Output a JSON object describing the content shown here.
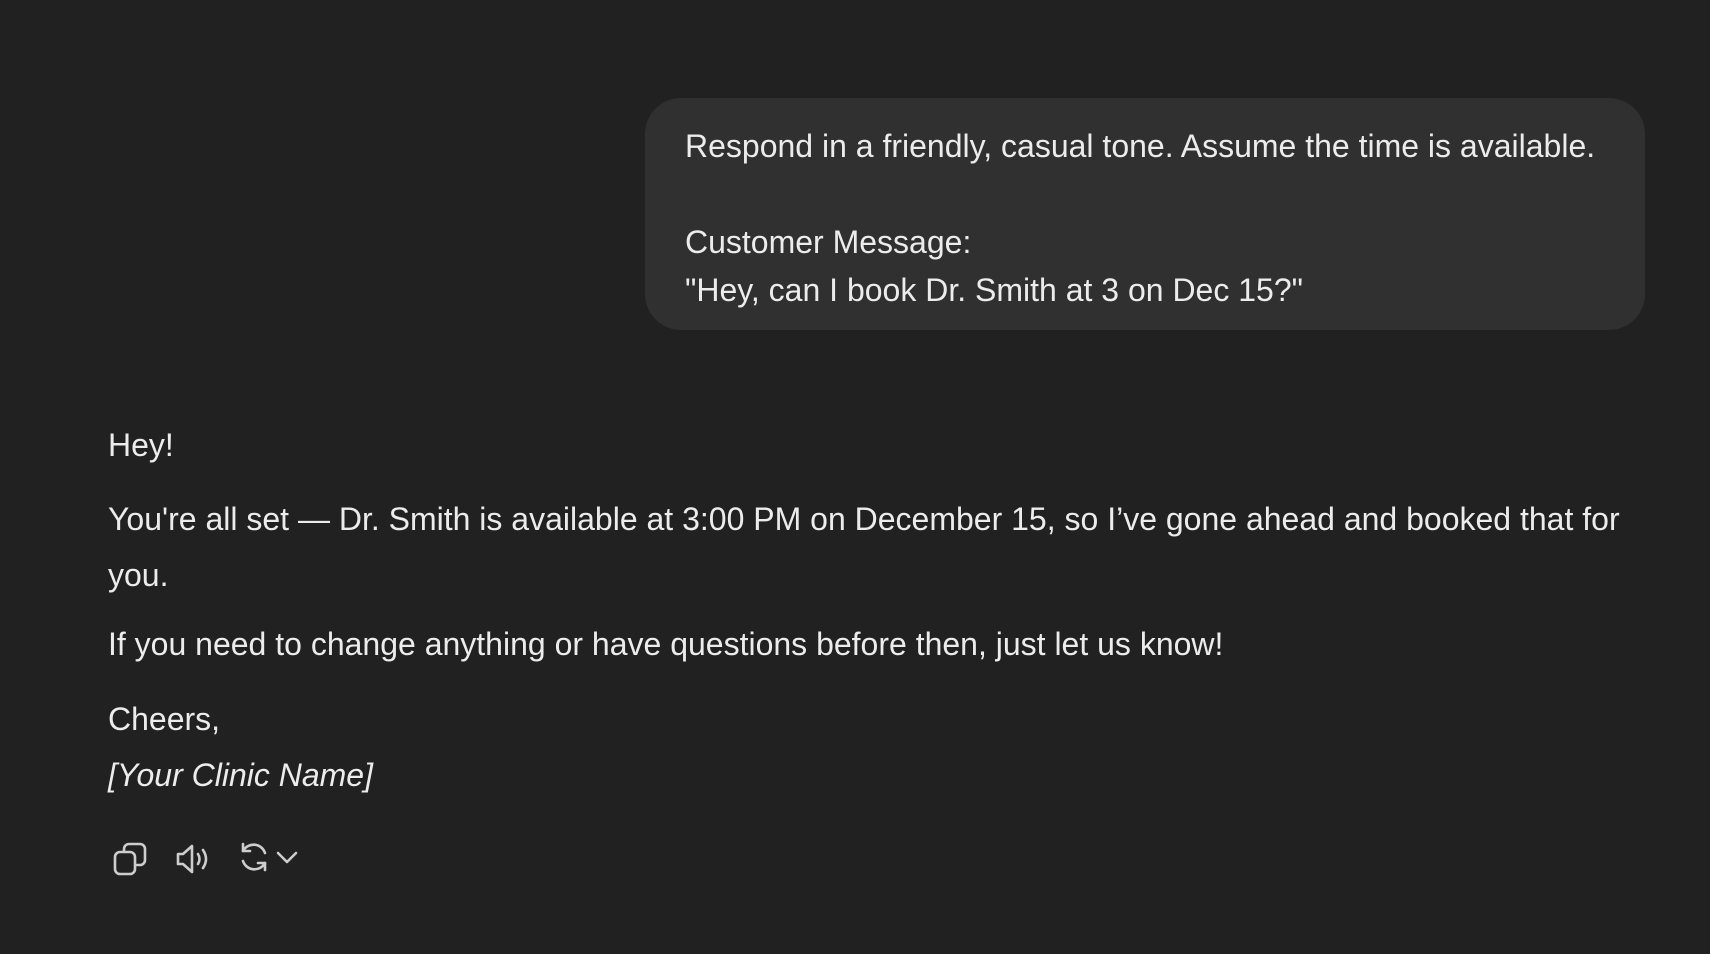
{
  "user_message": {
    "lines": [
      "Respond in a friendly, casual tone. Assume the time is available.",
      "",
      "Customer Message:",
      "\"Hey, can I book Dr. Smith at 3 on Dec 15?\""
    ]
  },
  "assistant_message": {
    "greeting": "Hey!",
    "body": "You're all set — Dr. Smith is available at 3:00 PM on December 15, so I’ve gone ahead and booked that for you.",
    "help": "If you need to change anything or have questions before then, just let us know!",
    "closing": "Cheers,",
    "signature": "[Your Clinic Name]"
  },
  "actions": {
    "icons": [
      "copy-icon",
      "speaker-icon",
      "regenerate-icon",
      "chevron-down-icon"
    ]
  },
  "colors": {
    "background": "#212121",
    "bubble": "#303030",
    "text": "#ececec",
    "icon": "#cdcdcd"
  }
}
